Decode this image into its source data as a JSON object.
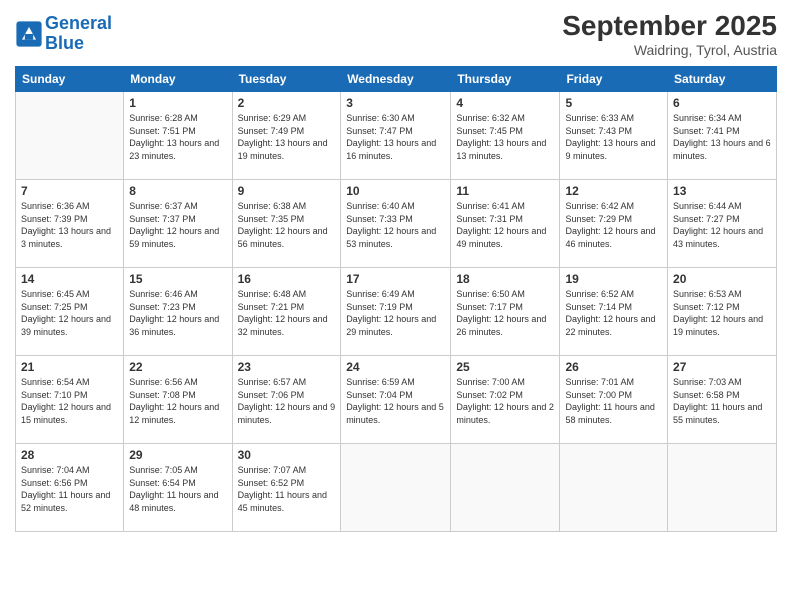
{
  "logo": {
    "line1": "General",
    "line2": "Blue"
  },
  "header": {
    "month": "September 2025",
    "location": "Waidring, Tyrol, Austria"
  },
  "days_of_week": [
    "Sunday",
    "Monday",
    "Tuesday",
    "Wednesday",
    "Thursday",
    "Friday",
    "Saturday"
  ],
  "weeks": [
    [
      {
        "day": "",
        "sunrise": "",
        "sunset": "",
        "daylight": ""
      },
      {
        "day": "1",
        "sunrise": "Sunrise: 6:28 AM",
        "sunset": "Sunset: 7:51 PM",
        "daylight": "Daylight: 13 hours and 23 minutes."
      },
      {
        "day": "2",
        "sunrise": "Sunrise: 6:29 AM",
        "sunset": "Sunset: 7:49 PM",
        "daylight": "Daylight: 13 hours and 19 minutes."
      },
      {
        "day": "3",
        "sunrise": "Sunrise: 6:30 AM",
        "sunset": "Sunset: 7:47 PM",
        "daylight": "Daylight: 13 hours and 16 minutes."
      },
      {
        "day": "4",
        "sunrise": "Sunrise: 6:32 AM",
        "sunset": "Sunset: 7:45 PM",
        "daylight": "Daylight: 13 hours and 13 minutes."
      },
      {
        "day": "5",
        "sunrise": "Sunrise: 6:33 AM",
        "sunset": "Sunset: 7:43 PM",
        "daylight": "Daylight: 13 hours and 9 minutes."
      },
      {
        "day": "6",
        "sunrise": "Sunrise: 6:34 AM",
        "sunset": "Sunset: 7:41 PM",
        "daylight": "Daylight: 13 hours and 6 minutes."
      }
    ],
    [
      {
        "day": "7",
        "sunrise": "Sunrise: 6:36 AM",
        "sunset": "Sunset: 7:39 PM",
        "daylight": "Daylight: 13 hours and 3 minutes."
      },
      {
        "day": "8",
        "sunrise": "Sunrise: 6:37 AM",
        "sunset": "Sunset: 7:37 PM",
        "daylight": "Daylight: 12 hours and 59 minutes."
      },
      {
        "day": "9",
        "sunrise": "Sunrise: 6:38 AM",
        "sunset": "Sunset: 7:35 PM",
        "daylight": "Daylight: 12 hours and 56 minutes."
      },
      {
        "day": "10",
        "sunrise": "Sunrise: 6:40 AM",
        "sunset": "Sunset: 7:33 PM",
        "daylight": "Daylight: 12 hours and 53 minutes."
      },
      {
        "day": "11",
        "sunrise": "Sunrise: 6:41 AM",
        "sunset": "Sunset: 7:31 PM",
        "daylight": "Daylight: 12 hours and 49 minutes."
      },
      {
        "day": "12",
        "sunrise": "Sunrise: 6:42 AM",
        "sunset": "Sunset: 7:29 PM",
        "daylight": "Daylight: 12 hours and 46 minutes."
      },
      {
        "day": "13",
        "sunrise": "Sunrise: 6:44 AM",
        "sunset": "Sunset: 7:27 PM",
        "daylight": "Daylight: 12 hours and 43 minutes."
      }
    ],
    [
      {
        "day": "14",
        "sunrise": "Sunrise: 6:45 AM",
        "sunset": "Sunset: 7:25 PM",
        "daylight": "Daylight: 12 hours and 39 minutes."
      },
      {
        "day": "15",
        "sunrise": "Sunrise: 6:46 AM",
        "sunset": "Sunset: 7:23 PM",
        "daylight": "Daylight: 12 hours and 36 minutes."
      },
      {
        "day": "16",
        "sunrise": "Sunrise: 6:48 AM",
        "sunset": "Sunset: 7:21 PM",
        "daylight": "Daylight: 12 hours and 32 minutes."
      },
      {
        "day": "17",
        "sunrise": "Sunrise: 6:49 AM",
        "sunset": "Sunset: 7:19 PM",
        "daylight": "Daylight: 12 hours and 29 minutes."
      },
      {
        "day": "18",
        "sunrise": "Sunrise: 6:50 AM",
        "sunset": "Sunset: 7:17 PM",
        "daylight": "Daylight: 12 hours and 26 minutes."
      },
      {
        "day": "19",
        "sunrise": "Sunrise: 6:52 AM",
        "sunset": "Sunset: 7:14 PM",
        "daylight": "Daylight: 12 hours and 22 minutes."
      },
      {
        "day": "20",
        "sunrise": "Sunrise: 6:53 AM",
        "sunset": "Sunset: 7:12 PM",
        "daylight": "Daylight: 12 hours and 19 minutes."
      }
    ],
    [
      {
        "day": "21",
        "sunrise": "Sunrise: 6:54 AM",
        "sunset": "Sunset: 7:10 PM",
        "daylight": "Daylight: 12 hours and 15 minutes."
      },
      {
        "day": "22",
        "sunrise": "Sunrise: 6:56 AM",
        "sunset": "Sunset: 7:08 PM",
        "daylight": "Daylight: 12 hours and 12 minutes."
      },
      {
        "day": "23",
        "sunrise": "Sunrise: 6:57 AM",
        "sunset": "Sunset: 7:06 PM",
        "daylight": "Daylight: 12 hours and 9 minutes."
      },
      {
        "day": "24",
        "sunrise": "Sunrise: 6:59 AM",
        "sunset": "Sunset: 7:04 PM",
        "daylight": "Daylight: 12 hours and 5 minutes."
      },
      {
        "day": "25",
        "sunrise": "Sunrise: 7:00 AM",
        "sunset": "Sunset: 7:02 PM",
        "daylight": "Daylight: 12 hours and 2 minutes."
      },
      {
        "day": "26",
        "sunrise": "Sunrise: 7:01 AM",
        "sunset": "Sunset: 7:00 PM",
        "daylight": "Daylight: 11 hours and 58 minutes."
      },
      {
        "day": "27",
        "sunrise": "Sunrise: 7:03 AM",
        "sunset": "Sunset: 6:58 PM",
        "daylight": "Daylight: 11 hours and 55 minutes."
      }
    ],
    [
      {
        "day": "28",
        "sunrise": "Sunrise: 7:04 AM",
        "sunset": "Sunset: 6:56 PM",
        "daylight": "Daylight: 11 hours and 52 minutes."
      },
      {
        "day": "29",
        "sunrise": "Sunrise: 7:05 AM",
        "sunset": "Sunset: 6:54 PM",
        "daylight": "Daylight: 11 hours and 48 minutes."
      },
      {
        "day": "30",
        "sunrise": "Sunrise: 7:07 AM",
        "sunset": "Sunset: 6:52 PM",
        "daylight": "Daylight: 11 hours and 45 minutes."
      },
      {
        "day": "",
        "sunrise": "",
        "sunset": "",
        "daylight": ""
      },
      {
        "day": "",
        "sunrise": "",
        "sunset": "",
        "daylight": ""
      },
      {
        "day": "",
        "sunrise": "",
        "sunset": "",
        "daylight": ""
      },
      {
        "day": "",
        "sunrise": "",
        "sunset": "",
        "daylight": ""
      }
    ]
  ]
}
